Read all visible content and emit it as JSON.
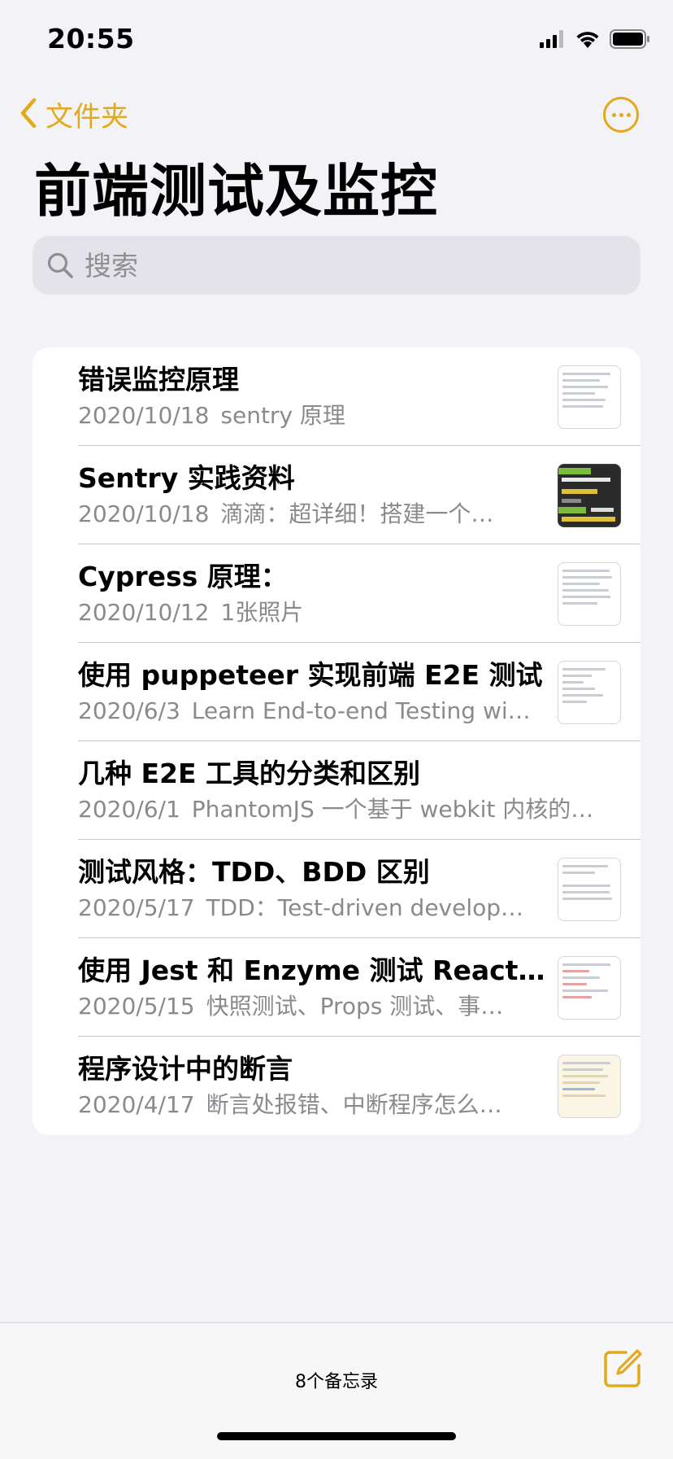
{
  "status_bar": {
    "time": "20:55"
  },
  "nav": {
    "back_label": "文件夹",
    "title": "前端测试及监控"
  },
  "search": {
    "placeholder": "搜索"
  },
  "notes": [
    {
      "title": "错误监控原理",
      "date": "2020/10/18",
      "preview": "sentry 原理",
      "has_thumbnail": true
    },
    {
      "title": "Sentry 实践资料",
      "date": "2020/10/18",
      "preview": "滴滴：超详细！搭建一个…",
      "has_thumbnail": true
    },
    {
      "title": "Cypress 原理：",
      "date": "2020/10/12",
      "preview": "1张照片",
      "has_thumbnail": true
    },
    {
      "title": "使用 puppeteer 实现前端 E2E 测试",
      "date": "2020/6/3",
      "preview": "Learn End-to-end Testing wi…",
      "has_thumbnail": true
    },
    {
      "title": "几种 E2E 工具的分类和区别",
      "date": "2020/6/1",
      "preview": "PhantomJS 一个基于 webkit 内核的…",
      "has_thumbnail": false
    },
    {
      "title": "测试风格：TDD、BDD 区别",
      "date": "2020/5/17",
      "preview": "TDD：Test-driven develop…",
      "has_thumbnail": true
    },
    {
      "title": "使用 Jest 和 Enzyme 测试 React…",
      "date": "2020/5/15",
      "preview": "快照测试、Props 测试、事…",
      "has_thumbnail": true
    },
    {
      "title": "程序设计中的断言",
      "date": "2020/4/17",
      "preview": "断言处报错、中断程序怎么…",
      "has_thumbnail": true
    }
  ],
  "toolbar": {
    "count_label": "8个备忘录"
  },
  "colors": {
    "accent": "#e2a91b",
    "background": "#f2f2f7"
  }
}
